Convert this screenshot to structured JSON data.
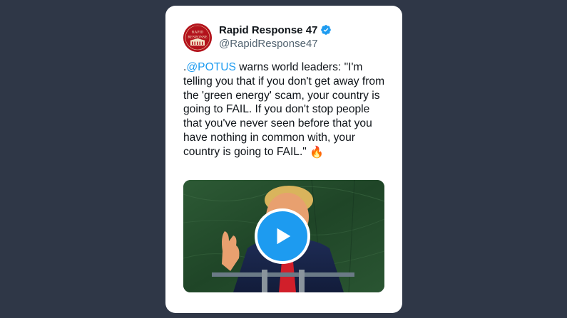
{
  "tweet": {
    "author": {
      "display_name": "Rapid Response 47",
      "handle": "@RapidResponse47",
      "avatar_text_top": "RAPID",
      "avatar_text_bottom": "RESPONSE",
      "verified": true
    },
    "text": {
      "prefix": ".",
      "mention": "@POTUS",
      "body": " warns world leaders: \"I'm telling you that if you don't get away from the 'green energy' scam, your country is going to FAIL. If you don't stop people that you've never seen before that you have nothing in common with, your country is going to FAIL.\" ",
      "emoji": "🔥"
    },
    "media": {
      "type": "video",
      "play_icon": "play-icon"
    }
  },
  "colors": {
    "background": "#2f3747",
    "card": "#ffffff",
    "mention": "#1d9bf0",
    "verified_badge": "#1d9bf0",
    "play_button": "#1d9bf0",
    "avatar": "#b3121b"
  }
}
